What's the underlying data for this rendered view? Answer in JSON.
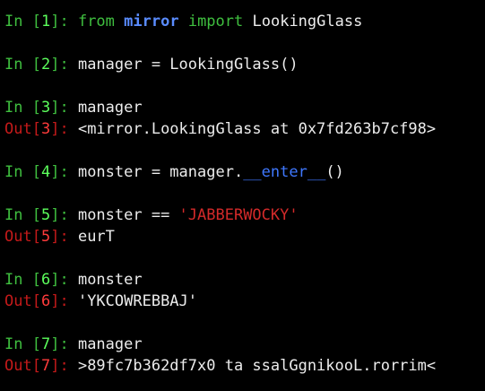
{
  "colors": {
    "background": "#000000",
    "in_prompt": "#3fbf3f",
    "out_prompt": "#c41a1a",
    "keyword": "#3fbf3f",
    "module": "#5a8cff",
    "dunder": "#3f78ff",
    "string": "#d32a2a",
    "text": "#ececec"
  },
  "prompts": {
    "in_word": "In ",
    "out_word": "Out",
    "open": "[",
    "close": "]",
    "sep": ": "
  },
  "cells": [
    {
      "n": "1",
      "input": {
        "kw_from": "from",
        "module": "mirror",
        "kw_import": "import",
        "name": "LookingGlass"
      }
    },
    {
      "n": "2",
      "input": {
        "text": "manager = LookingGlass()"
      }
    },
    {
      "n": "3",
      "input": {
        "text": "manager"
      },
      "output": "<mirror.LookingGlass at 0x7fd263b7cf98>"
    },
    {
      "n": "4",
      "input": {
        "before": "monster = manager.",
        "dunder": "__enter__",
        "after": "()"
      }
    },
    {
      "n": "5",
      "input": {
        "before": "monster == ",
        "string": "'JABBERWOCKY'"
      },
      "output": "eurT"
    },
    {
      "n": "6",
      "input": {
        "text": "monster"
      },
      "output": "'YKCOWREBBAJ'"
    },
    {
      "n": "7",
      "input": {
        "text": "manager"
      },
      "output": ">89fc7b362df7x0 ta ssalGgnikooL.rorrim<"
    }
  ]
}
